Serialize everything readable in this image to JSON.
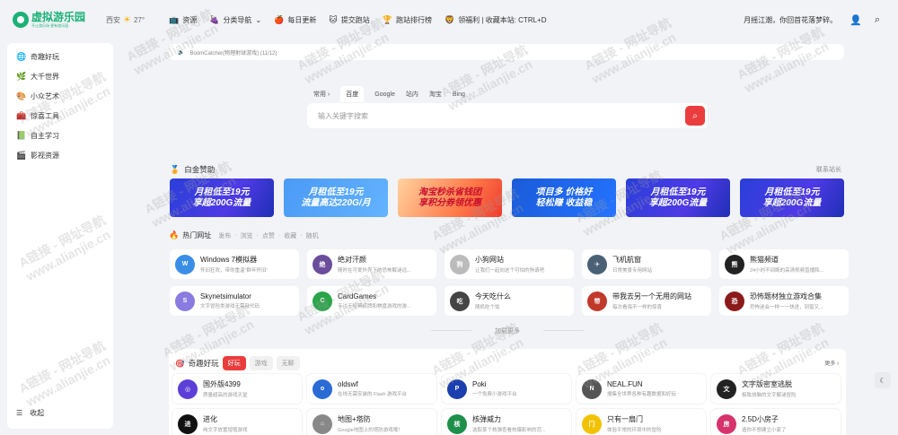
{
  "logo": {
    "title": "虚拟游乐园",
    "subtitle": "不止游乐场 更有游乐园"
  },
  "weather": {
    "icon": "sun-icon",
    "city": "西安",
    "temp": "27°"
  },
  "nav": [
    {
      "icon": "📺",
      "label": "资源"
    },
    {
      "icon": "🍇",
      "label": "分类导航",
      "dropdown": "⌄"
    },
    {
      "icon": "🍎",
      "label": "每日更新"
    },
    {
      "icon": "🐱",
      "label": "提交跑站"
    },
    {
      "icon": "🏆",
      "label": "跑站排行榜"
    },
    {
      "icon": "🦁",
      "label": "领福利 | 收藏本站: CTRL+D"
    }
  ],
  "header_right": {
    "slogan": "月摇江潮，你回首花落梦碎。",
    "user_icon": "👤",
    "search_icon": "⌕"
  },
  "sidebar": {
    "items": [
      {
        "icon": "🌐",
        "label": "奇趣好玩"
      },
      {
        "icon": "🌿",
        "label": "大千世界"
      },
      {
        "icon": "🎨",
        "label": "小众艺术"
      },
      {
        "icon": "🧰",
        "label": "惊喜工具"
      },
      {
        "icon": "📗",
        "label": "自主学习"
      },
      {
        "icon": "🎬",
        "label": "影视资源"
      }
    ],
    "collapse": {
      "icon": "☰",
      "label": "收起"
    }
  },
  "notice": {
    "icon": "🔈",
    "text": "BoomCatcher(物理射球游戏) (11/12)"
  },
  "search": {
    "tabs": [
      "常用",
      "百度",
      "Google",
      "站内",
      "淘宝",
      "Bing"
    ],
    "arrow": "›",
    "active": "百度",
    "placeholder": "输入关键字搜索",
    "button_icon": "⌕"
  },
  "sponsor": {
    "title": "白金赞助",
    "link": "联系站长",
    "ads": [
      {
        "line1": "月租低至19元",
        "line2": "享超200G流量",
        "style": "blue"
      },
      {
        "line1": "月租低至19元",
        "line2": "流量高达220G/月",
        "style": "lblue"
      },
      {
        "line1": "淘宝秒杀省钱团",
        "line2": "享积分券领优惠",
        "style": "red"
      },
      {
        "line1": "项目多 价格好",
        "line2": "轻松赚 收益稳",
        "style": "navy"
      },
      {
        "line1": "月租低至19元",
        "line2": "享超200G流量",
        "style": "blue"
      },
      {
        "line1": "月租低至19元",
        "line2": "享超200G流量",
        "style": "blue"
      }
    ]
  },
  "hot": {
    "title": "热门网址",
    "filters": [
      "发布",
      "浏览",
      "点赞",
      "收藏",
      "随机"
    ],
    "sep": "·",
    "cards": [
      {
        "name": "Windows 7模拟器",
        "desc": "怀旧狂欢，带你重温\"群年怀旧\"",
        "color": "#3a8ee6",
        "glyph": "W"
      },
      {
        "name": "绝对汗颜",
        "desc": "随时在可爱外壳下的恐怖解谜远...",
        "color": "#6a4e9c",
        "glyph": "绝"
      },
      {
        "name": "小狗网站",
        "desc": "让我们一起向这个可怕的狗请吧",
        "color": "#bbb",
        "glyph": "狗"
      },
      {
        "name": "飞机航窗",
        "desc": "日常美景专用网站",
        "color": "#4a6175",
        "glyph": "✈"
      },
      {
        "name": "熊猫频道",
        "desc": "24小时不间断的高清视频直播和...",
        "color": "#222",
        "glyph": "熊"
      },
      {
        "name": "Skynetsimulator",
        "desc": "文字冒险类游戏无需敲代码",
        "color": "#8a7be0",
        "glyph": "S"
      },
      {
        "name": "CardGames",
        "desc": "专注于经典纸牌和棋盘游戏的游...",
        "color": "#2aa54a",
        "glyph": "C"
      },
      {
        "name": "今天吃什么",
        "desc": "随机吃个饭",
        "color": "#444",
        "glyph": "吃"
      },
      {
        "name": "带我去另一个无用的网站",
        "desc": "每次看海不一样的惊喜",
        "color": "#c0392b",
        "glyph": "带"
      },
      {
        "name": "恐怖题材独立游戏合集",
        "desc": "恐怖迷会一样一一快进，到窗又...",
        "color": "#8b1a1a",
        "glyph": "恐"
      }
    ]
  },
  "more": "加载更多",
  "fun": {
    "title": "奇趣好玩",
    "tabs": [
      "好玩",
      "游戏",
      "无聊"
    ],
    "active": "好玩",
    "more": "更多 ›",
    "cards": [
      {
        "name": "国外版4399",
        "desc": "质量超高的游戏天堂",
        "color": "#5c3fd6",
        "glyph": "◎"
      },
      {
        "name": "oldswf",
        "desc": "在线无需安装的 Flash 游戏平台",
        "color": "#2b6bd6",
        "glyph": "o"
      },
      {
        "name": "Poki",
        "desc": "一个免费小游戏平台",
        "color": "#1b3fae",
        "glyph": "P"
      },
      {
        "name": "NEAL.FUN",
        "desc": "搜集全世界各种有趣数据和好玩",
        "color": "#555",
        "glyph": "N"
      },
      {
        "name": "文字版密室逃脱",
        "desc": "极致烧脑的文字解谜冒险",
        "color": "#222",
        "glyph": "文"
      },
      {
        "name": "进化",
        "desc": "纯文字放置增殖游戏",
        "color": "#111",
        "glyph": "进"
      },
      {
        "name": "地图+塔防",
        "desc": "Google地图上的塔防游戏哦！",
        "color": "#888",
        "glyph": "⌂"
      },
      {
        "name": "核弹威力",
        "desc": "选取某个核弹查看核爆影响的范...",
        "color": "#1e8f4a",
        "glyph": "核"
      },
      {
        "name": "只有一扇门",
        "desc": "体验平常的环境中的冒险",
        "color": "#f2c200",
        "glyph": "门"
      },
      {
        "name": "2.5D小房子",
        "desc": "造你不想建立小家了",
        "color": "#d6336c",
        "glyph": "房"
      }
    ]
  },
  "watermark": {
    "line1": "A链接 - 网址导航",
    "line2": "www.alianjie.cn"
  },
  "float_icon": "☾"
}
